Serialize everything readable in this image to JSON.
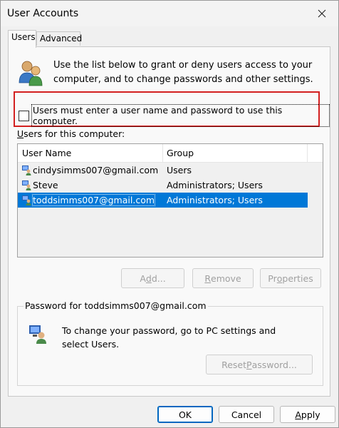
{
  "window": {
    "title": "User Accounts"
  },
  "tabs": [
    {
      "label": "Users",
      "active": true
    },
    {
      "label": "Advanced",
      "active": false
    }
  ],
  "intro_text": "Use the list below to grant or deny users access to your computer, and to change passwords and other settings.",
  "login_checkbox": {
    "label": "Users must enter a user name and password to use this computer.",
    "checked": false
  },
  "users_label": {
    "mnemonic": "U",
    "rest": "sers for this computer:"
  },
  "users_table": {
    "columns": [
      "User Name",
      "Group"
    ],
    "rows": [
      {
        "name": "cindysimms007@gmail.com",
        "group": "Users",
        "selected": false
      },
      {
        "name": "Steve",
        "group": "Administrators; Users",
        "selected": false
      },
      {
        "name": "toddsimms007@gmail.com",
        "group": "Administrators; Users",
        "selected": true
      }
    ]
  },
  "user_buttons": {
    "add": {
      "pre": "A",
      "mnemonic": "d",
      "post": "d..."
    },
    "remove": {
      "pre": "",
      "mnemonic": "R",
      "post": "emove"
    },
    "properties": {
      "pre": "Pr",
      "mnemonic": "o",
      "post": "perties"
    }
  },
  "password_group": {
    "title": "Password for toddsimms007@gmail.com",
    "text": "To change your password, go to PC settings and select Users.",
    "reset_button": {
      "pre": "Reset ",
      "mnemonic": "P",
      "post": "assword..."
    }
  },
  "footer_buttons": {
    "ok": "OK",
    "cancel": "Cancel",
    "apply": {
      "mnemonic": "A",
      "post": "pply"
    }
  },
  "colors": {
    "selection": "#0078d7",
    "highlight_border": "#d32020",
    "default_button_border": "#0067c0"
  },
  "icons": [
    "users-icon",
    "close-icon",
    "user-icon",
    "password-icon"
  ]
}
